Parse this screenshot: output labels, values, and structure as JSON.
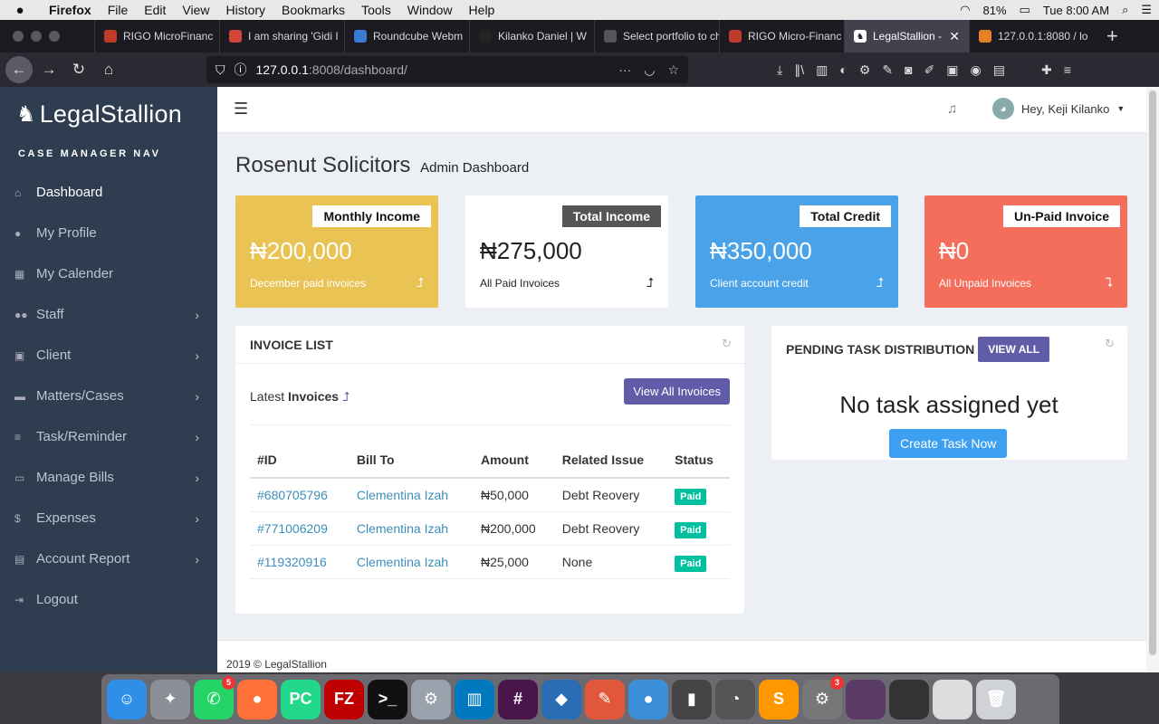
{
  "mac_menubar": {
    "app": "Firefox",
    "items": [
      "File",
      "Edit",
      "View",
      "History",
      "Bookmarks",
      "Tools",
      "Window",
      "Help"
    ],
    "battery": "81%",
    "clock": "Tue 8:00 AM"
  },
  "browser": {
    "tabs": [
      {
        "label": "RIGO MicroFinanc",
        "color": "#c0392b"
      },
      {
        "label": "I am sharing 'Gidi I",
        "color": "#d44638"
      },
      {
        "label": "Roundcube Webm",
        "color": "#3a7bd5"
      },
      {
        "label": "Kilanko Daniel | W",
        "color": "#222222"
      },
      {
        "label": "Select portfolio to cha",
        "color": "#555555"
      },
      {
        "label": "RIGO Micro-Financ",
        "color": "#c0392b"
      },
      {
        "label": "LegalStallion -",
        "color": "#ffffff",
        "active": true
      },
      {
        "label": "127.0.0.1:8080 / lo",
        "color": "#e67e22"
      }
    ],
    "url_host": "127.0.0.1",
    "url_path": ":8008/dashboard/"
  },
  "sidebar": {
    "logo": "LegalStallion",
    "header": "CASE MANAGER NAV",
    "items": [
      {
        "label": "Dashboard",
        "icon": "home-icon",
        "glyph": "⌂",
        "chevron": false,
        "active": true
      },
      {
        "label": "My Profile",
        "icon": "user-icon",
        "glyph": "●",
        "chevron": false
      },
      {
        "label": "My Calender",
        "icon": "calendar-icon",
        "glyph": "▦",
        "chevron": false
      },
      {
        "label": "Staff",
        "icon": "users-icon",
        "glyph": "●●",
        "chevron": true
      },
      {
        "label": "Client",
        "icon": "lock-icon",
        "glyph": "▣",
        "chevron": true
      },
      {
        "label": "Matters/Cases",
        "icon": "briefcase-icon",
        "glyph": "▬",
        "chevron": true
      },
      {
        "label": "Task/Reminder",
        "icon": "list-icon",
        "glyph": "≡",
        "chevron": true
      },
      {
        "label": "Manage Bills",
        "icon": "money-icon",
        "glyph": "▭",
        "chevron": true
      },
      {
        "label": "Expenses",
        "icon": "dollar-icon",
        "glyph": "$",
        "chevron": true
      },
      {
        "label": "Account Report",
        "icon": "book-icon",
        "glyph": "▤",
        "chevron": true
      },
      {
        "label": "Logout",
        "icon": "logout-icon",
        "glyph": "⇥",
        "chevron": false
      }
    ]
  },
  "topbar": {
    "greeting": "Hey, Keji Kilanko"
  },
  "page": {
    "title": "Rosenut Solicitors",
    "subtitle": "Admin Dashboard"
  },
  "cards": [
    {
      "label": "Monthly Income",
      "value": "₦200,000",
      "sub": "December paid invoices",
      "arrow": "⮥",
      "bg": "#e9c354",
      "fg": "#ffffff"
    },
    {
      "label": "Total Income",
      "value": "₦275,000",
      "sub": "All Paid Invoices",
      "arrow": "⮥",
      "bg": "#ffffff",
      "fg": "#222222",
      "labelbg": "#555555",
      "labelfg": "#ffffff"
    },
    {
      "label": "Total Credit",
      "value": "₦350,000",
      "sub": "Client account credit",
      "arrow": "⮥",
      "bg": "#4aa3e8",
      "fg": "#ffffff"
    },
    {
      "label": "Un-Paid Invoice",
      "value": "₦0",
      "sub": "All Unpaid Invoices",
      "arrow": "⮧",
      "bg": "#f56d5b",
      "fg": "#ffffff"
    }
  ],
  "invoices": {
    "title": "INVOICE LIST",
    "latest_prefix": "Latest",
    "latest_bold": "Invoices",
    "view_all": "View All Invoices",
    "columns": [
      "#ID",
      "Bill To",
      "Amount",
      "Related Issue",
      "Status"
    ],
    "rows": [
      {
        "id": "#680705796",
        "bill_to": "Clementina Izah",
        "amount": "₦50,000",
        "issue": "Debt Reovery",
        "status": "Paid"
      },
      {
        "id": "#771006209",
        "bill_to": "Clementina Izah",
        "amount": "₦200,000",
        "issue": "Debt Reovery",
        "status": "Paid"
      },
      {
        "id": "#119320916",
        "bill_to": "Clementina Izah",
        "amount": "₦25,000",
        "issue": "None",
        "status": "Paid"
      }
    ]
  },
  "tasks": {
    "title": "PENDING TASK DISTRIBUTION",
    "view_all": "VIEW ALL",
    "empty": "No task assigned yet",
    "create": "Create Task Now"
  },
  "footer": "2019 © LegalStallion",
  "dock": [
    {
      "name": "finder-icon",
      "color": "#2f8ee8",
      "glyph": "☺"
    },
    {
      "name": "launchpad-icon",
      "color": "#8a8f98",
      "glyph": "✦"
    },
    {
      "name": "whatsapp-icon",
      "color": "#25d366",
      "glyph": "✆",
      "badge": "5"
    },
    {
      "name": "firefox-icon",
      "color": "#ff7139",
      "glyph": "●"
    },
    {
      "name": "pycharm-icon",
      "color": "#21d789",
      "glyph": "PC"
    },
    {
      "name": "filezilla-icon",
      "color": "#bf0000",
      "glyph": "FZ"
    },
    {
      "name": "terminal-icon",
      "color": "#111111",
      "glyph": ">_"
    },
    {
      "name": "system-prefs-icon",
      "color": "#9aa2ad",
      "glyph": "⚙"
    },
    {
      "name": "trello-icon",
      "color": "#0079bf",
      "glyph": "▥"
    },
    {
      "name": "slack-icon",
      "color": "#4a154b",
      "glyph": "#"
    },
    {
      "name": "elephant-icon",
      "color": "#2a6db5",
      "glyph": "◆"
    },
    {
      "name": "pencil-app-icon",
      "color": "#e2573b",
      "glyph": "✎"
    },
    {
      "name": "tableplus-icon",
      "color": "#3b8fd9",
      "glyph": "●"
    },
    {
      "name": "equalizer-icon",
      "color": "#444444",
      "glyph": "▮"
    },
    {
      "name": "timer-icon",
      "color": "#555555",
      "glyph": "◔"
    },
    {
      "name": "sublime-icon",
      "color": "#ff9800",
      "glyph": "S"
    },
    {
      "name": "app-store-icon",
      "color": "#777777",
      "glyph": "⚙",
      "badge": "3"
    },
    {
      "name": "window-thumb-icon",
      "color": "#5a3b66",
      "glyph": ""
    },
    {
      "name": "window-thumb-icon-2",
      "color": "#333333",
      "glyph": ""
    },
    {
      "name": "window-thumb-icon-3",
      "color": "#dddddd",
      "glyph": ""
    },
    {
      "name": "trash-icon",
      "color": "#cfd2d6",
      "glyph": "🗑"
    }
  ]
}
